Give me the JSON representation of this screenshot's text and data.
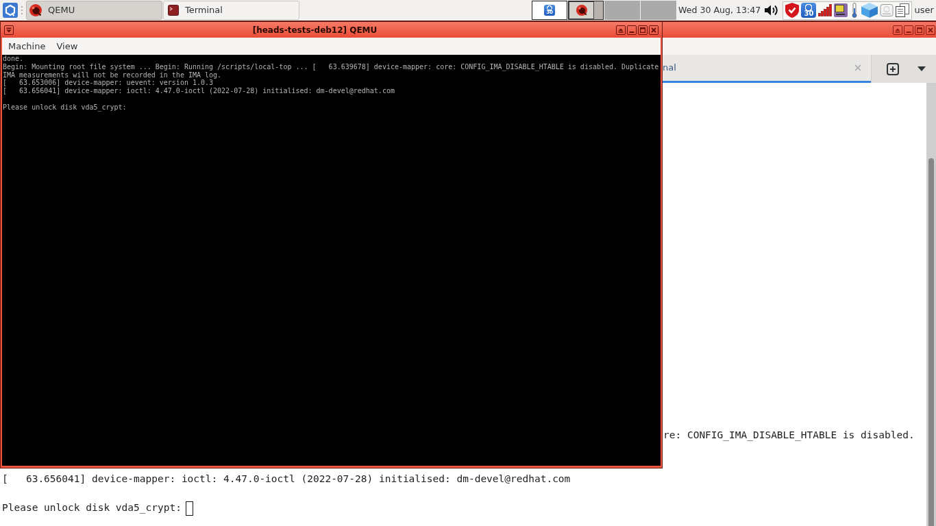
{
  "taskbar": {
    "tasks": [
      {
        "label": "QEMU",
        "kind": "qemu",
        "selected": true
      },
      {
        "label": "Terminal",
        "kind": "terminal",
        "selected": false
      }
    ],
    "pager": [
      {
        "selected": false,
        "windows": [
          {
            "kind": "counter",
            "badge": "30"
          }
        ]
      },
      {
        "selected": true,
        "windows": [
          {
            "kind": "qemu"
          }
        ]
      },
      {
        "selected": false
      },
      {
        "selected": false
      }
    ],
    "clock": "Wed 30 Aug, 13:47",
    "tray": [
      {
        "kind": "shield"
      },
      {
        "kind": "counter",
        "badge": "30"
      },
      {
        "kind": "signal"
      },
      {
        "kind": "device"
      },
      {
        "kind": "thermometer"
      },
      {
        "kind": "cube"
      },
      {
        "kind": "disk"
      },
      {
        "kind": "documents"
      }
    ],
    "user": "user"
  },
  "qemu_window": {
    "title": "[heads-tests-deb12] QEMU",
    "menu": [
      "Machine",
      "View"
    ],
    "console": {
      "lines": [
        "done.",
        "Begin: Mounting root file system ... Begin: Running /scripts/local-top ... [   63.639678] device-mapper: core: CONFIG_IMA_DISABLE_HTABLE is disabled. Duplicate",
        "IMA measurements will not be recorded in the IMA log.",
        "[   63.653006] device-mapper: uevent: version 1.0.3",
        "[   63.656041] device-mapper: ioctl: 4.47.0-ioctl (2022-07-28) initialised: dm-devel@redhat.com"
      ],
      "prompt": "Please unlock disk vda5_crypt:"
    }
  },
  "terminal_window": {
    "tab": {
      "label": "nal",
      "selected": true
    },
    "output": [
      "re: CONFIG_IMA_DISABLE_HTABLE is disabled.",
      "[   63.656041] device-mapper: ioctl: 4.47.0-ioctl (2022-07-28) initialised: dm-devel@redhat.com"
    ],
    "prompt": "Please unlock disk vda5_crypt:",
    "cursor": true
  }
}
